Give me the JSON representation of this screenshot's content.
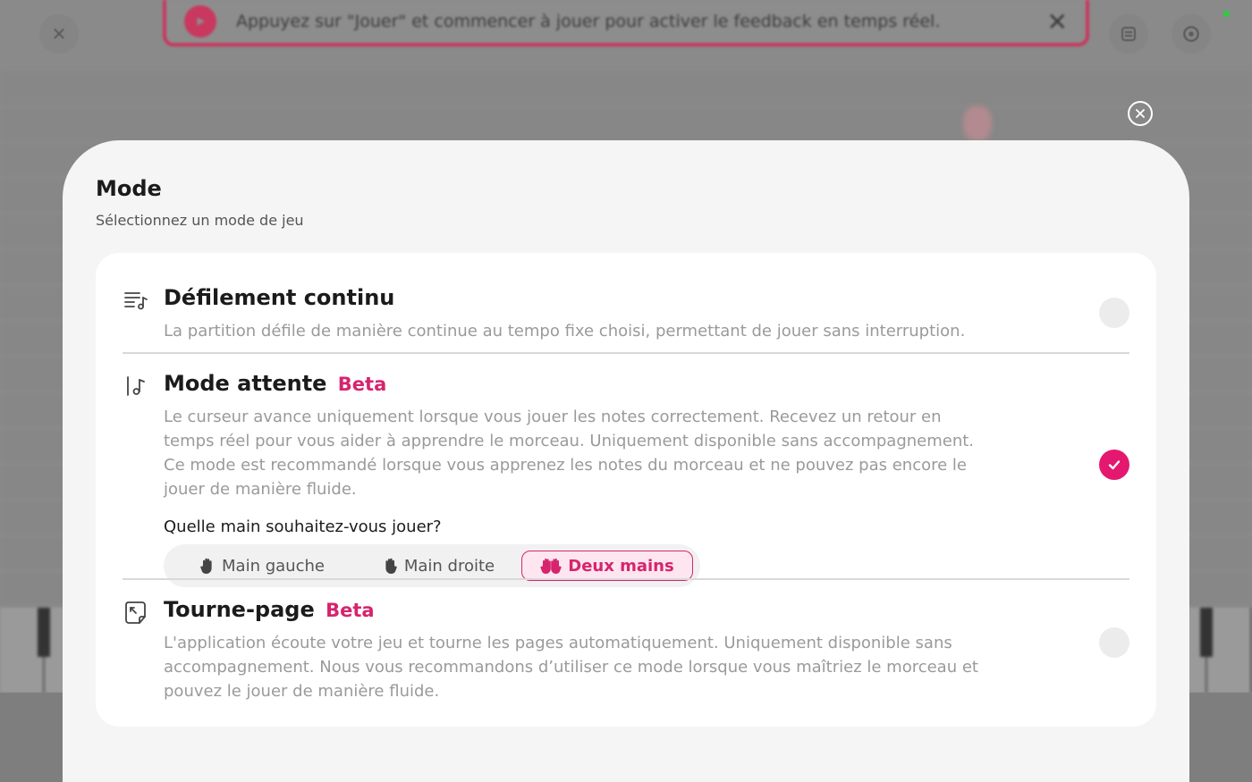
{
  "background": {
    "banner_text": "Appuyez sur \"Jouer\" et commencer à jouer pour activer le feedback en temps réel.",
    "banner_close": "✕",
    "close_glyph": "✕",
    "icons": [
      "play-icon",
      "close-icon",
      "list-icon",
      "settings-icon"
    ]
  },
  "modal": {
    "title": "Mode",
    "subtitle": "Sélectionnez un mode de jeu",
    "options": [
      {
        "title": "Défilement continu",
        "badge": "",
        "description": "La partition défile de manière continue au tempo fixe choisi, permettant de jouer sans interruption.",
        "selected": false,
        "icon": "scroll-list-icon"
      },
      {
        "title": "Mode attente",
        "badge": "Beta",
        "description": "Le curseur avance uniquement lorsque vous jouer les notes correctement. Recevez un retour en temps réel pour vous aider à apprendre le morceau. Uniquement disponible sans accompagnement. Ce mode est recommandé lorsque vous apprenez les notes du morceau et ne pouvez pas encore le jouer de manière fluide.",
        "selected": true,
        "icon": "cursor-note-icon"
      },
      {
        "title": "Tourne-page",
        "badge": "Beta",
        "description": "L'application écoute votre jeu et tourne les pages automatiquement. Uniquement disponible sans accompagnement. Nous vous recommandons d’utiliser ce mode lorsque vous maîtriez le morceau et pouvez le jouer de manière fluide.",
        "selected": false,
        "icon": "page-turn-icon"
      }
    ],
    "hand_question": "Quelle main souhaitez-vous jouer?",
    "hands": [
      {
        "label": "Main gauche",
        "active": false
      },
      {
        "label": "Main droite",
        "active": false
      },
      {
        "label": "Deux mains",
        "active": true
      }
    ]
  },
  "colors": {
    "accent": "#d6246e",
    "accent_bg": "#fde6ef",
    "radio_selected": "#e5186f",
    "sheet_bg": "#f5f5f5",
    "card_bg": "#ffffff"
  }
}
